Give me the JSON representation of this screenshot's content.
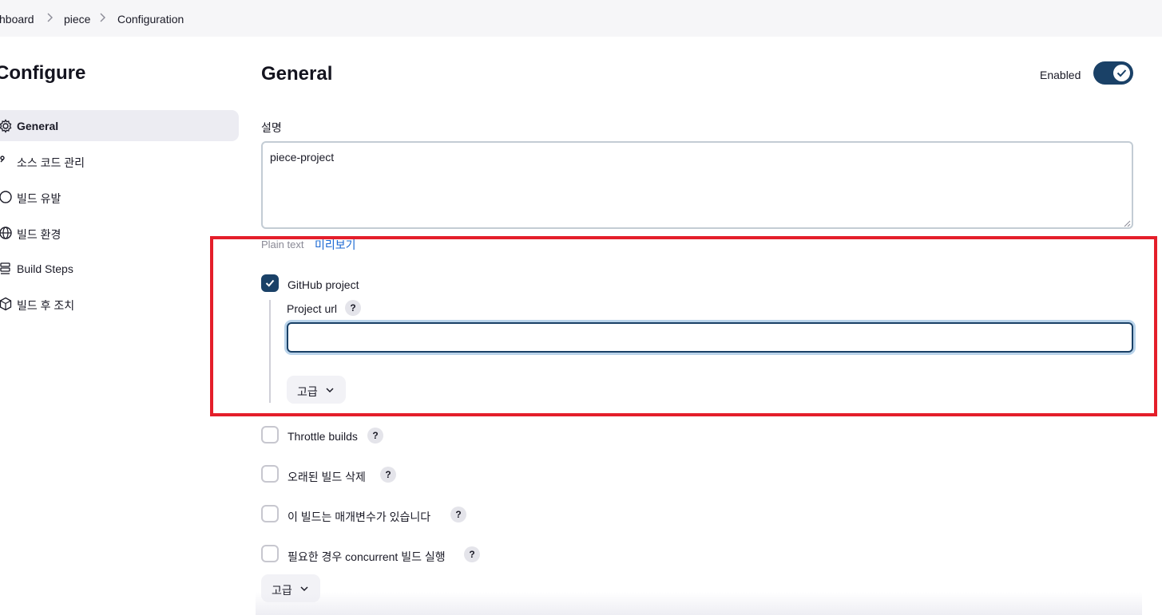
{
  "breadcrumb": {
    "items": [
      "hboard",
      "piece",
      "Configuration"
    ]
  },
  "sidebar": {
    "title": "Configure",
    "items": [
      {
        "label": "General",
        "icon": "gear-icon",
        "active": true
      },
      {
        "label": "소스 코드 관리",
        "icon": "branch-icon",
        "active": false
      },
      {
        "label": "빌드 유발",
        "icon": "clock-icon",
        "active": false
      },
      {
        "label": "빌드 환경",
        "icon": "globe-icon",
        "active": false
      },
      {
        "label": "Build Steps",
        "icon": "list-icon",
        "active": false
      },
      {
        "label": "빌드 후 조치",
        "icon": "cube-icon",
        "active": false
      }
    ]
  },
  "main": {
    "section_title": "General",
    "enabled_label": "Enabled",
    "enabled": true,
    "description": {
      "label": "설명",
      "value": "piece-project",
      "plain_text_label": "Plain text",
      "preview_link": "미리보기"
    },
    "github_project": {
      "label": "GitHub project",
      "checked": true,
      "project_url_label": "Project url",
      "project_url_value": "",
      "help": "?",
      "advanced_label": "고급"
    },
    "options": [
      {
        "label": "Throttle builds",
        "checked": false,
        "help": "?"
      },
      {
        "label": "오래된 빌드 삭제",
        "checked": false,
        "help": "?"
      },
      {
        "label": "이 빌드는 매개변수가 있습니다",
        "checked": false,
        "help": "?"
      },
      {
        "label": "필요한 경우 concurrent 빌드 실행",
        "checked": false,
        "help": "?"
      }
    ],
    "advanced_label": "고급"
  },
  "colors": {
    "accent": "#1a4167",
    "link": "#1a67d2",
    "highlight": "#e41e2a"
  }
}
